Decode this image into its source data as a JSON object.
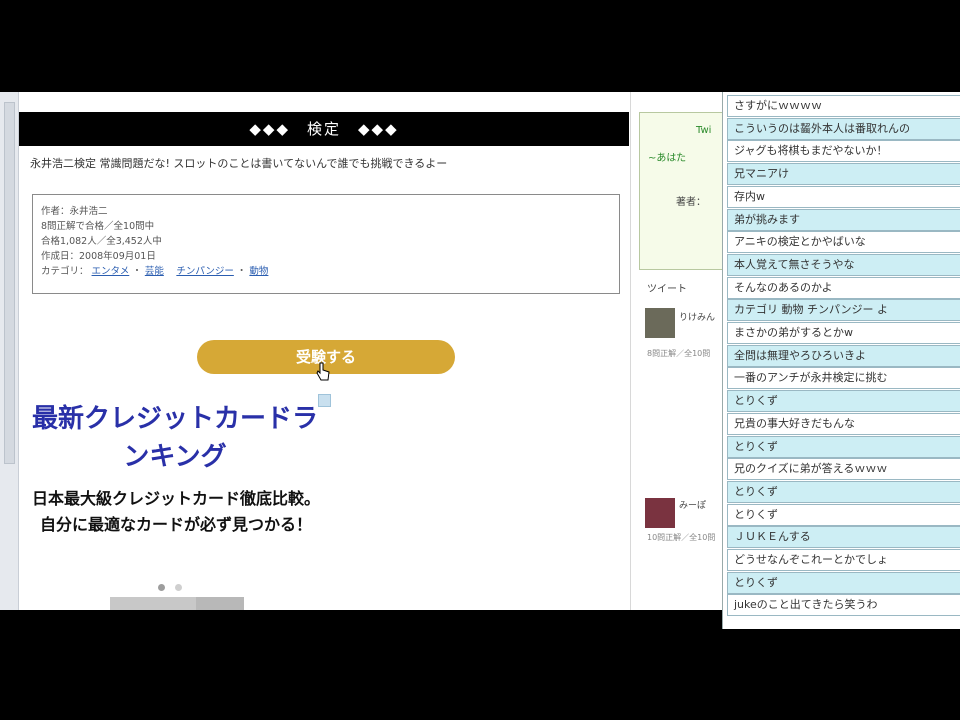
{
  "page": {
    "header_title": "◆◆◆　検定　◆◆◆",
    "description": "永井浩二検定 常識問題だな! スロットのことは書いてないんで誰でも挑戦できるよー",
    "info": {
      "author": "作者：永井浩二",
      "pass_rule": "8問正解で合格／全10問中",
      "passers": "合格1,082人／全3,452人中",
      "date": "作成日：2008年09月01日",
      "category_label": "カテゴリ：",
      "category_links": [
        "エンタメ",
        "芸能",
        "チンパンジー",
        "動物"
      ]
    },
    "exam_button": "受験する"
  },
  "ad": {
    "title": "最新クレジットカードランキング",
    "body": "日本最大級クレジットカード徹底比較。自分に最適なカードが必ず見つかる！"
  },
  "right": {
    "green1": "Twi",
    "green2": "~あはた",
    "author_short": "著者：",
    "tweet_label": "ツイート",
    "tweet1_name": "りけみん",
    "tweet1_text": "8問正解／全10問",
    "tweet2_name": "みーぽ",
    "tweet2_text": "10問正解／全10問"
  },
  "comments": [
    "さすがにｗｗｗｗ",
    "こういうのは齧外本人は番取れんの",
    "ジャグも将棋もまだやないか！",
    "兄マニアけ",
    "存内w",
    "弟が挑みます",
    "アニキの検定とかやばいな",
    "本人覚えて無さそうやな",
    "そんなのあるのかよ",
    "カテゴリ 動物 チンパンジー よ",
    "まさかの弟がするとかw",
    "全問は無理やろひろいきよ",
    "一番のアンチが永井検定に挑む",
    "とりくず",
    "兄貴の事大好きだもんな",
    "とりくず",
    "兄のクイズに弟が答えるｗｗｗ",
    "とりくず",
    "とりくず",
    "ＪＵＫＥんする",
    "どうせなんぞこれーとかでしょ",
    "とりくず",
    "jukeのこと出てきたら笑うわ"
  ]
}
